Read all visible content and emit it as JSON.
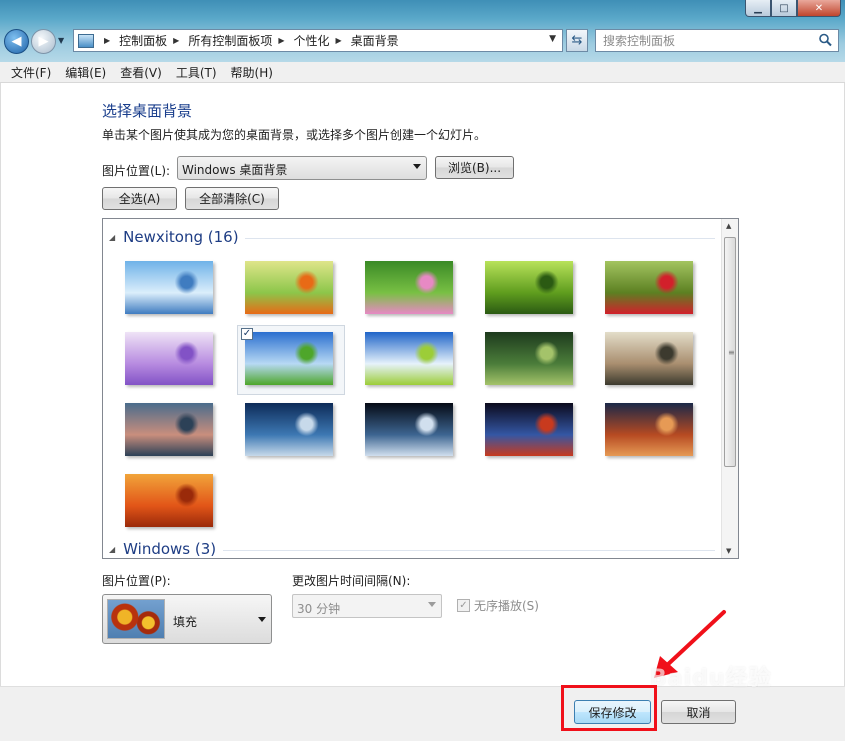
{
  "window": {
    "minimize": "▁",
    "maximize": "□",
    "close": "✕"
  },
  "nav": {
    "breadcrumbs": [
      "控制面板",
      "所有控制面板项",
      "个性化",
      "桌面背景"
    ],
    "search_placeholder": "搜索控制面板"
  },
  "menu": [
    "文件(F)",
    "编辑(E)",
    "查看(V)",
    "工具(T)",
    "帮助(H)"
  ],
  "main": {
    "title": "选择桌面背景",
    "description": "单击某个图片使其成为您的桌面背景，或选择多个图片创建一个幻灯片。",
    "picture_location_label": "图片位置(L):",
    "picture_location_value": "Windows 桌面背景",
    "browse_button": "浏览(B)...",
    "select_all_button": "全选(A)",
    "clear_all_button": "全部清除(C)",
    "groups": [
      {
        "name": "Newxitong (16)"
      },
      {
        "name": "Windows (3)"
      }
    ],
    "thumbnails": [
      {
        "name": "blue-sky-flowers",
        "colors": [
          "#6fb2e8",
          "#dbeefb",
          "#3f7cc0"
        ],
        "selected": false
      },
      {
        "name": "orange-lantern-flower",
        "colors": [
          "#dfe58a",
          "#8cc64a",
          "#e86a16"
        ],
        "selected": false
      },
      {
        "name": "pink-cosmos-flower",
        "colors": [
          "#3a8a26",
          "#79c044",
          "#e789c4"
        ],
        "selected": false
      },
      {
        "name": "green-leaves",
        "colors": [
          "#b8e25a",
          "#5f9d1e",
          "#2b5a13"
        ],
        "selected": false
      },
      {
        "name": "red-tulips",
        "colors": [
          "#a3c460",
          "#5c8022",
          "#d2202b"
        ],
        "selected": false
      },
      {
        "name": "purple-flowers",
        "colors": [
          "#efe3f6",
          "#b78be0",
          "#8252c6"
        ],
        "selected": false
      },
      {
        "name": "meadow-blue-sky",
        "colors": [
          "#2a6fcf",
          "#b7d9f4",
          "#4ea62a"
        ],
        "selected": true
      },
      {
        "name": "clouds-grass",
        "colors": [
          "#1f64c8",
          "#e6f2fb",
          "#9ccd38"
        ],
        "selected": false
      },
      {
        "name": "girl-forest-bicycle",
        "colors": [
          "#1d3a1d",
          "#4b7d3a",
          "#a4c36a"
        ],
        "selected": false
      },
      {
        "name": "girl-scarf-portrait",
        "colors": [
          "#e3ddc9",
          "#a98e6f",
          "#3c3a2e"
        ],
        "selected": false
      },
      {
        "name": "sea-sunset",
        "colors": [
          "#4a6c8c",
          "#c98e7d",
          "#2c4157"
        ],
        "selected": false
      },
      {
        "name": "night-sky-horizon",
        "colors": [
          "#0d2b58",
          "#3d78b3",
          "#c7d9ea"
        ],
        "selected": false
      },
      {
        "name": "earth-from-space",
        "colors": [
          "#050a14",
          "#3d6591",
          "#d1dfee"
        ],
        "selected": false
      },
      {
        "name": "planet-nebula",
        "colors": [
          "#0b0a1c",
          "#3457a4",
          "#c83a1e"
        ],
        "selected": false
      },
      {
        "name": "rock-arch-sunset",
        "colors": [
          "#1a2848",
          "#b64a22",
          "#e69a55"
        ],
        "selected": false
      },
      {
        "name": "orange-abstract",
        "colors": [
          "#f1a43a",
          "#e25518",
          "#9a2a0a"
        ],
        "selected": false
      }
    ],
    "picture_position_label": "图片位置(P):",
    "picture_position_value": "填充",
    "interval_label": "更改图片时间间隔(N):",
    "interval_value": "30 分钟",
    "shuffle_label": "无序播放(S)",
    "shuffle_checked": true
  },
  "footer": {
    "save_button": "保存修改",
    "cancel_button": "取消"
  },
  "watermark": "Baidu经验",
  "colors": {
    "title_blue": "#1a3e8c",
    "annotation_red": "#f0101a"
  }
}
